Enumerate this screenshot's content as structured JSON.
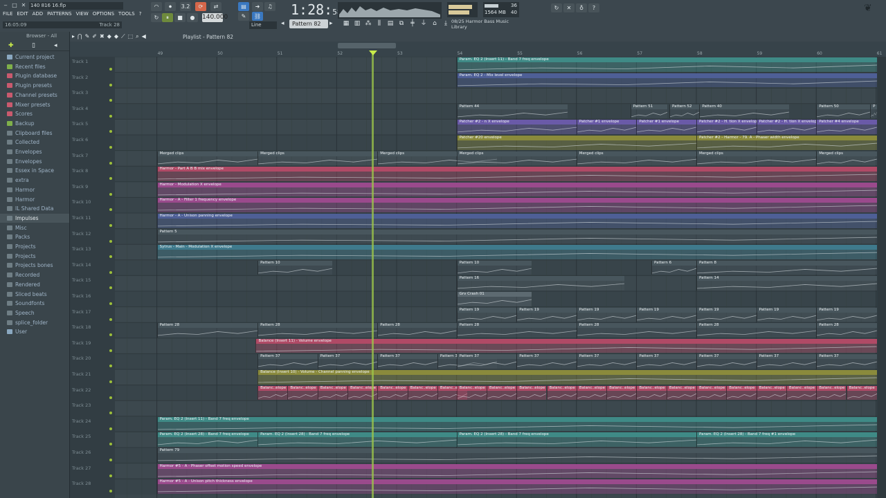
{
  "window": {
    "title": "140 816 16.flp",
    "minimize": "‒",
    "maximize": "□",
    "close": "✕"
  },
  "menu": [
    "FILE",
    "EDIT",
    "ADD",
    "PATTERNS",
    "VIEW",
    "OPTIONS",
    "TOOLS",
    "?"
  ],
  "hint": {
    "left": "16:05:09",
    "right": "Track 28"
  },
  "transport": {
    "tempo": "140.000",
    "time_main": "1:28",
    "time_sub": "58",
    "time_label": "M:S:CS",
    "pattern": "Pattern 82",
    "snap": "Line",
    "cpu": "36",
    "mem": "1564 MB",
    "poly": "40",
    "news": [
      "08/25  Harmor Bass Music",
      "Library"
    ]
  },
  "browser": {
    "header": "Browser - All",
    "items": [
      {
        "label": "Current project",
        "color": "#8aa8c0"
      },
      {
        "label": "Recent files",
        "color": "#7fb04a"
      },
      {
        "label": "Plugin database",
        "color": "#c95a6e"
      },
      {
        "label": "Plugin presets",
        "color": "#c95a6e"
      },
      {
        "label": "Channel presets",
        "color": "#c95a6e"
      },
      {
        "label": "Mixer presets",
        "color": "#c95a6e"
      },
      {
        "label": "Scores",
        "color": "#c95a6e"
      },
      {
        "label": "Backup",
        "color": "#7fb04a"
      },
      {
        "label": "Clipboard files",
        "color": "#6f7e85"
      },
      {
        "label": "Collected",
        "color": "#6f7e85"
      },
      {
        "label": "Envelopes",
        "color": "#6f7e85"
      },
      {
        "label": "Envelopes",
        "color": "#6f7e85"
      },
      {
        "label": "Essex in Space",
        "color": "#6f7e85"
      },
      {
        "label": "extra",
        "color": "#6f7e85"
      },
      {
        "label": "Harmor",
        "color": "#6f7e85"
      },
      {
        "label": "Harmor",
        "color": "#6f7e85"
      },
      {
        "label": "IL Shared Data",
        "color": "#6f7e85"
      },
      {
        "label": "Impulses",
        "color": "#6f7e85",
        "selected": true
      },
      {
        "label": "Misc",
        "color": "#6f7e85"
      },
      {
        "label": "Packs",
        "color": "#6f7e85"
      },
      {
        "label": "Projects",
        "color": "#6f7e85"
      },
      {
        "label": "Projects",
        "color": "#6f7e85"
      },
      {
        "label": "Projects bones",
        "color": "#6f7e85"
      },
      {
        "label": "Recorded",
        "color": "#6f7e85"
      },
      {
        "label": "Rendered",
        "color": "#6f7e85"
      },
      {
        "label": "Sliced beats",
        "color": "#6f7e85"
      },
      {
        "label": "Soundfonts",
        "color": "#6f7e85"
      },
      {
        "label": "Speech",
        "color": "#6f7e85"
      },
      {
        "label": "splice_folder",
        "color": "#6f7e85"
      },
      {
        "label": "User",
        "color": "#8aa8c0"
      }
    ]
  },
  "playlist": {
    "title": "Playlist - Pattern 82",
    "bars": [
      "49",
      "50",
      "51",
      "52",
      "53",
      "54",
      "55",
      "56",
      "57",
      "58",
      "59",
      "60",
      "61"
    ],
    "tracks": [
      "Track 1",
      "Track 2",
      "Track 3",
      "Track 4",
      "Track 5",
      "Track 6",
      "Track 7",
      "Track 8",
      "Track 9",
      "Track 10",
      "Track 11",
      "Track 12",
      "Track 13",
      "Track 14",
      "Track 15",
      "Track 16",
      "Track 17",
      "Track 18",
      "Track 19",
      "Track 20",
      "Track 21",
      "Track 22",
      "Track 23",
      "Track 24",
      "Track 25",
      "Track 26",
      "Track 27",
      "Track 28"
    ],
    "clips": [
      {
        "t": 0,
        "b": 54,
        "len": 7.2,
        "label": "Param. EQ 2 (Insert 11) - Band 7 freq envelope",
        "color": "#3f8a86"
      },
      {
        "t": 1,
        "b": 54,
        "len": 7.2,
        "label": "Param. EQ 2 - Mix level envelope",
        "color": "#4e5f96"
      },
      {
        "t": 3,
        "b": 54,
        "len": 1.85,
        "label": "Pattern 44",
        "color": "#48565d"
      },
      {
        "t": 3,
        "b": 56.9,
        "len": 0.62,
        "label": "Pattern 51",
        "color": "#48565d"
      },
      {
        "t": 3,
        "b": 57.55,
        "len": 0.5,
        "label": "Pattern 52",
        "color": "#48565d"
      },
      {
        "t": 3,
        "b": 58.05,
        "len": 1.5,
        "label": "Pattern 40",
        "color": "#48565d"
      },
      {
        "t": 3,
        "b": 60,
        "len": 0.9,
        "label": "Pattern 50",
        "color": "#48565d"
      },
      {
        "t": 3,
        "b": 60.9,
        "len": 0.3,
        "label": "P",
        "color": "#48565d"
      },
      {
        "t": 4,
        "b": 54,
        "len": 2,
        "label": "Patcher #2 - n X envelope",
        "color": "#6a5aa8"
      },
      {
        "t": 4,
        "b": 56,
        "len": 1,
        "label": "Patcher #1 envelope",
        "color": "#6a5aa8"
      },
      {
        "t": 4,
        "b": 57,
        "len": 1,
        "label": "Patcher #1 envelope",
        "color": "#6a5aa8"
      },
      {
        "t": 4,
        "b": 58,
        "len": 1,
        "label": "Patcher #2 - H. tion X envelope",
        "color": "#6a5aa8"
      },
      {
        "t": 4,
        "b": 59,
        "len": 1,
        "label": "Patcher #2 - H. tion X envelope",
        "color": "#6a5aa8"
      },
      {
        "t": 4,
        "b": 60,
        "len": 1.2,
        "label": "Patcher #4 envelope",
        "color": "#6a5aa8"
      },
      {
        "t": 5,
        "b": 54,
        "len": 4,
        "label": "Patcher #20 envelope",
        "color": "#8a8a3c"
      },
      {
        "t": 5,
        "b": 58,
        "len": 3.2,
        "label": "Patcher #2 - Harmor - 79. A - Phaser width envelope",
        "color": "#8a8a3c"
      },
      {
        "t": 6,
        "b": 49,
        "len": 1.68,
        "label": "Merged clips",
        "color": "#48565d"
      },
      {
        "t": 6,
        "b": 50.68,
        "len": 2,
        "label": "Merged clips",
        "color": "#48565d"
      },
      {
        "t": 6,
        "b": 52.68,
        "len": 2,
        "label": "Merged clips",
        "color": "#48565d"
      },
      {
        "t": 6,
        "b": 54,
        "len": 2,
        "label": "Merged clips",
        "color": "#48565d"
      },
      {
        "t": 6,
        "b": 56,
        "len": 2,
        "label": "Merged clips",
        "color": "#48565d"
      },
      {
        "t": 6,
        "b": 58,
        "len": 2,
        "label": "Merged clips",
        "color": "#48565d"
      },
      {
        "t": 6,
        "b": 60,
        "len": 1.2,
        "label": "Merged clips",
        "color": "#48565d"
      },
      {
        "t": 7,
        "b": 49,
        "len": 12.2,
        "label": "Harmor - Part A B B mix envelope",
        "color": "#b04a66"
      },
      {
        "t": 8,
        "b": 49,
        "len": 12.2,
        "label": "Harmor - Modulation X envelope",
        "color": "#9a4a8c"
      },
      {
        "t": 9,
        "b": 49,
        "len": 12.2,
        "label": "Harmor - A - Filter 1 frequency envelope",
        "color": "#9a4a8c"
      },
      {
        "t": 10,
        "b": 49,
        "len": 12.2,
        "label": "Harmor - A - Unison panning envelope",
        "color": "#4e5f96"
      },
      {
        "t": 11,
        "b": 49,
        "len": 12.2,
        "label": "Pattern 5",
        "color": "#48565d"
      },
      {
        "t": 12,
        "b": 49,
        "len": 12.2,
        "label": "Sytrus - Main - Modulation X envelope",
        "color": "#3f7a8c"
      },
      {
        "t": 13,
        "b": 50.68,
        "len": 1.25,
        "label": "Pattern 10",
        "color": "#48565d"
      },
      {
        "t": 13,
        "b": 54,
        "len": 1.25,
        "label": "Pattern 10",
        "color": "#48565d"
      },
      {
        "t": 13,
        "b": 57.25,
        "len": 0.75,
        "label": "Pattern 6",
        "color": "#48565d"
      },
      {
        "t": 13,
        "b": 58,
        "len": 3.2,
        "label": "Pattern 8",
        "color": "#48565d"
      },
      {
        "t": 14,
        "b": 54,
        "len": 2.8,
        "label": "Pattern 16",
        "color": "#48565d"
      },
      {
        "t": 14,
        "b": 58,
        "len": 3.2,
        "label": "Pattern 14",
        "color": "#48565d"
      },
      {
        "t": 15,
        "b": 54,
        "len": 1.25,
        "label": "Grv Crash 01",
        "color": "#5d6a71"
      },
      {
        "t": 16,
        "b": 54,
        "len": 1,
        "label": "Pattern 19",
        "color": "#48565d"
      },
      {
        "t": 16,
        "b": 55,
        "len": 1,
        "label": "Pattern 19",
        "color": "#48565d"
      },
      {
        "t": 16,
        "b": 56,
        "len": 1,
        "label": "Pattern 19",
        "color": "#48565d"
      },
      {
        "t": 16,
        "b": 57,
        "len": 1,
        "label": "Pattern 19",
        "color": "#48565d"
      },
      {
        "t": 16,
        "b": 58,
        "len": 1,
        "label": "Pattern 19",
        "color": "#48565d"
      },
      {
        "t": 16,
        "b": 59,
        "len": 1,
        "label": "Pattern 19",
        "color": "#48565d"
      },
      {
        "t": 16,
        "b": 60,
        "len": 1.2,
        "label": "Pattern 19",
        "color": "#48565d"
      },
      {
        "t": 17,
        "b": 49,
        "len": 1.68,
        "label": "Pattern 28",
        "color": "#48565d"
      },
      {
        "t": 17,
        "b": 50.68,
        "len": 2,
        "label": "Pattern 28",
        "color": "#48565d"
      },
      {
        "t": 17,
        "b": 52.68,
        "len": 1.32,
        "label": "Pattern 28",
        "color": "#48565d"
      },
      {
        "t": 17,
        "b": 54,
        "len": 2,
        "label": "Pattern 28",
        "color": "#48565d"
      },
      {
        "t": 17,
        "b": 56,
        "len": 2,
        "label": "Pattern 28",
        "color": "#48565d"
      },
      {
        "t": 17,
        "b": 58,
        "len": 2,
        "label": "Pattern 28",
        "color": "#48565d"
      },
      {
        "t": 17,
        "b": 60,
        "len": 1.2,
        "label": "Pattern 28",
        "color": "#48565d"
      },
      {
        "t": 18,
        "b": 50.65,
        "len": 10.55,
        "label": "Balance (Insert 11) - Volume envelope",
        "color": "#b04a66"
      },
      {
        "t": 19,
        "b": 50.68,
        "len": 1,
        "label": "Pattern 37",
        "color": "#48565d"
      },
      {
        "t": 19,
        "b": 51.68,
        "len": 1,
        "label": "Pattern 37",
        "color": "#48565d"
      },
      {
        "t": 19,
        "b": 52.68,
        "len": 1,
        "label": "Pattern 37",
        "color": "#48565d"
      },
      {
        "t": 19,
        "b": 53.68,
        "len": 1,
        "label": "Pattern 37",
        "color": "#48565d"
      },
      {
        "t": 19,
        "b": 54,
        "len": 1,
        "label": "Pattern 37",
        "color": "#48565d"
      },
      {
        "t": 19,
        "b": 55,
        "len": 1,
        "label": "Pattern 37",
        "color": "#48565d"
      },
      {
        "t": 19,
        "b": 56,
        "len": 1,
        "label": "Pattern 37",
        "color": "#48565d"
      },
      {
        "t": 19,
        "b": 57,
        "len": 1,
        "label": "Pattern 37",
        "color": "#48565d"
      },
      {
        "t": 19,
        "b": 58,
        "len": 1,
        "label": "Pattern 37",
        "color": "#48565d"
      },
      {
        "t": 19,
        "b": 59,
        "len": 1,
        "label": "Pattern 37",
        "color": "#48565d"
      },
      {
        "t": 19,
        "b": 60,
        "len": 1.2,
        "label": "Pattern 37",
        "color": "#48565d"
      },
      {
        "t": 20,
        "b": 50.68,
        "len": 10.5,
        "label": "Balance (Insert 10) - Volume - Channel panning envelope",
        "color": "#8a8a3c"
      },
      {
        "t": 21,
        "b": 50.68,
        "len": 0.5,
        "label": "Balanc..elope",
        "color": "#b04a66"
      },
      {
        "t": 21,
        "b": 51.18,
        "len": 0.5,
        "label": "Balanc..elope",
        "color": "#b04a66"
      },
      {
        "t": 21,
        "b": 51.68,
        "len": 0.5,
        "label": "Balanc..elope",
        "color": "#b04a66"
      },
      {
        "t": 21,
        "b": 52.18,
        "len": 0.5,
        "label": "Balanc..elope",
        "color": "#b04a66"
      },
      {
        "t": 21,
        "b": 52.68,
        "len": 0.5,
        "label": "Balanc..elope",
        "color": "#b04a66"
      },
      {
        "t": 21,
        "b": 53.18,
        "len": 0.5,
        "label": "Balanc..elope",
        "color": "#b04a66"
      },
      {
        "t": 21,
        "b": 53.68,
        "len": 0.5,
        "label": "Balanc..elope",
        "color": "#b04a66"
      },
      {
        "t": 21,
        "b": 54,
        "len": 0.5,
        "label": "Balanc..elope",
        "color": "#b04a66"
      },
      {
        "t": 21,
        "b": 54.5,
        "len": 0.5,
        "label": "Balanc..elope",
        "color": "#b04a66"
      },
      {
        "t": 21,
        "b": 55,
        "len": 0.5,
        "label": "Balanc..elope",
        "color": "#b04a66"
      },
      {
        "t": 21,
        "b": 55.5,
        "len": 0.5,
        "label": "Balanc..elope",
        "color": "#b04a66"
      },
      {
        "t": 21,
        "b": 56,
        "len": 0.5,
        "label": "Balanc..elope",
        "color": "#b04a66"
      },
      {
        "t": 21,
        "b": 56.5,
        "len": 0.5,
        "label": "Balanc..elope",
        "color": "#b04a66"
      },
      {
        "t": 21,
        "b": 57,
        "len": 0.5,
        "label": "Balanc..elope",
        "color": "#b04a66"
      },
      {
        "t": 21,
        "b": 57.5,
        "len": 0.5,
        "label": "Balanc..elope",
        "color": "#b04a66"
      },
      {
        "t": 21,
        "b": 58,
        "len": 0.5,
        "label": "Balanc..elope",
        "color": "#b04a66"
      },
      {
        "t": 21,
        "b": 58.5,
        "len": 0.5,
        "label": "Balanc..elope",
        "color": "#b04a66"
      },
      {
        "t": 21,
        "b": 59,
        "len": 0.5,
        "label": "Balanc..elope",
        "color": "#b04a66"
      },
      {
        "t": 21,
        "b": 59.5,
        "len": 0.5,
        "label": "Balanc..elope",
        "color": "#b04a66"
      },
      {
        "t": 21,
        "b": 60,
        "len": 0.5,
        "label": "Balanc..elope",
        "color": "#b04a66"
      },
      {
        "t": 21,
        "b": 60.5,
        "len": 0.7,
        "label": "Balanc..elope",
        "color": "#b04a66"
      },
      {
        "t": 23,
        "b": 49,
        "len": 12.2,
        "label": "Param. EQ 2 (Insert 11) - Band 7 freq envelope",
        "color": "#3f8a86"
      },
      {
        "t": 24,
        "b": 49,
        "len": 1.68,
        "label": "Param. EQ 2 (Insert 28) - Band 7 freq envelope",
        "color": "#3f8a86"
      },
      {
        "t": 24,
        "b": 50.68,
        "len": 3.32,
        "label": "Param. EQ 2 (Insert 28) - Band 7 freq envelope",
        "color": "#3f8a86"
      },
      {
        "t": 24,
        "b": 54,
        "len": 4,
        "label": "Param. EQ 2 (Insert 28) - Band 7 freq envelope",
        "color": "#3f8a86"
      },
      {
        "t": 24,
        "b": 58,
        "len": 3.2,
        "label": "Param. EQ 2 (Insert 28) - Band 7 freq #1 envelope",
        "color": "#3f8a86"
      },
      {
        "t": 25,
        "b": 49,
        "len": 12.2,
        "label": "Pattern 79",
        "color": "#48565d"
      },
      {
        "t": 26,
        "b": 49,
        "len": 12.2,
        "label": "Harmor #5 - A - Phaser offset motion speed envelope",
        "color": "#9a4a8c"
      },
      {
        "t": 27,
        "b": 49,
        "len": 12.2,
        "label": "Harmor #5 - A - Unison pitch thickness envelope",
        "color": "#9a4a8c"
      }
    ]
  }
}
